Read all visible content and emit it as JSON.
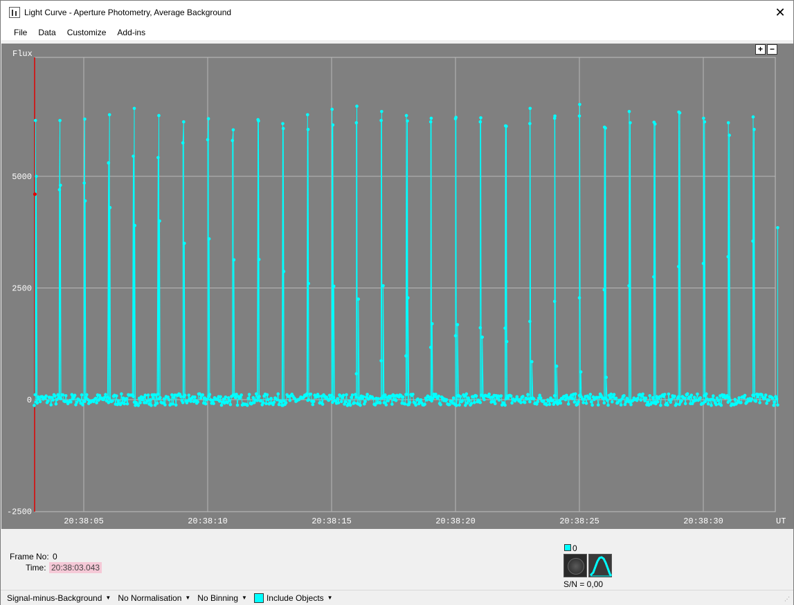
{
  "window": {
    "title": "Light Curve - Aperture Photometry, Average Background",
    "close_glyph": "✕"
  },
  "menu": {
    "items": [
      "File",
      "Data",
      "Customize",
      "Add-ins"
    ]
  },
  "zoom": {
    "plus": "+",
    "minus": "−"
  },
  "chart_data": {
    "type": "line",
    "ylabel": "Flux",
    "xlabel": "UT",
    "ylim": [
      -2500,
      7700
    ],
    "xlim": [
      3.0,
      33.0
    ],
    "yticks": [
      -2500,
      0,
      2500,
      5000
    ],
    "ytick_labels": [
      "-2500",
      "0",
      "2500",
      "5000"
    ],
    "xticks": [
      5,
      10,
      15,
      20,
      25,
      30
    ],
    "xtick_labels": [
      "20:38:05",
      "20:38:10",
      "20:38:15",
      "20:38:20",
      "20:38:25",
      "20:38:30"
    ],
    "grid": true,
    "series": [
      {
        "color": "#00ffff",
        "baseline": 0,
        "noise": 130,
        "peaks": [
          {
            "x": 3.05,
            "y": 6250
          },
          {
            "x": 4.04,
            "y": 6250
          },
          {
            "x": 5.04,
            "y": 6280
          },
          {
            "x": 6.04,
            "y": 6380
          },
          {
            "x": 7.04,
            "y": 6520
          },
          {
            "x": 8.03,
            "y": 6360
          },
          {
            "x": 9.03,
            "y": 6220
          },
          {
            "x": 10.03,
            "y": 6290
          },
          {
            "x": 11.03,
            "y": 6040
          },
          {
            "x": 12.03,
            "y": 6270
          },
          {
            "x": 13.03,
            "y": 6180
          },
          {
            "x": 14.03,
            "y": 6380
          },
          {
            "x": 15.02,
            "y": 6500
          },
          {
            "x": 16.02,
            "y": 6570
          },
          {
            "x": 17.02,
            "y": 6450
          },
          {
            "x": 18.02,
            "y": 6360
          },
          {
            "x": 19.02,
            "y": 6300
          },
          {
            "x": 20.02,
            "y": 6320
          },
          {
            "x": 21.02,
            "y": 6310
          },
          {
            "x": 22.02,
            "y": 6130
          },
          {
            "x": 23.01,
            "y": 6520
          },
          {
            "x": 24.01,
            "y": 6350
          },
          {
            "x": 25.01,
            "y": 6610
          },
          {
            "x": 26.01,
            "y": 6100
          },
          {
            "x": 27.01,
            "y": 6450
          },
          {
            "x": 28.01,
            "y": 6210
          },
          {
            "x": 29.01,
            "y": 6440
          },
          {
            "x": 30.01,
            "y": 6300
          },
          {
            "x": 31.01,
            "y": 6200
          },
          {
            "x": 32.01,
            "y": 6330
          }
        ],
        "mid_points": [
          {
            "x": 4.02,
            "y": 4700
          },
          {
            "x": 4.06,
            "y": 4800
          },
          {
            "x": 5.02,
            "y": 4850
          },
          {
            "x": 5.06,
            "y": 4450
          },
          {
            "x": 6.0,
            "y": 5300
          },
          {
            "x": 6.06,
            "y": 4300
          },
          {
            "x": 7.0,
            "y": 5450
          },
          {
            "x": 7.06,
            "y": 3900
          },
          {
            "x": 8.0,
            "y": 5420
          },
          {
            "x": 8.06,
            "y": 4000
          },
          {
            "x": 9.0,
            "y": 5750
          },
          {
            "x": 9.06,
            "y": 3500
          },
          {
            "x": 10.0,
            "y": 5820
          },
          {
            "x": 10.06,
            "y": 3600
          },
          {
            "x": 11.0,
            "y": 5800
          },
          {
            "x": 11.06,
            "y": 3130
          },
          {
            "x": 12.05,
            "y": 6240
          },
          {
            "x": 12.07,
            "y": 3140
          },
          {
            "x": 13.05,
            "y": 6070
          },
          {
            "x": 13.07,
            "y": 2870
          },
          {
            "x": 14.05,
            "y": 6050
          },
          {
            "x": 14.07,
            "y": 2600
          },
          {
            "x": 15.05,
            "y": 6150
          },
          {
            "x": 15.09,
            "y": 2540
          },
          {
            "x": 16.0,
            "y": 6200
          },
          {
            "x": 16.08,
            "y": 2250
          },
          {
            "x": 17.0,
            "y": 6250
          },
          {
            "x": 17.08,
            "y": 2550
          },
          {
            "x": 18.06,
            "y": 6240
          },
          {
            "x": 18.08,
            "y": 2280
          },
          {
            "x": 19.0,
            "y": 6220
          },
          {
            "x": 19.06,
            "y": 1700
          },
          {
            "x": 20.0,
            "y": 6290
          },
          {
            "x": 20.08,
            "y": 1680
          },
          {
            "x": 21.0,
            "y": 6220
          },
          {
            "x": 21.08,
            "y": 1400
          },
          {
            "x": 22.05,
            "y": 6120
          },
          {
            "x": 22.07,
            "y": 1300
          },
          {
            "x": 23.0,
            "y": 6180
          },
          {
            "x": 23.08,
            "y": 850
          },
          {
            "x": 24.0,
            "y": 6300
          },
          {
            "x": 24.08,
            "y": 750
          },
          {
            "x": 25.0,
            "y": 6350
          },
          {
            "x": 25.06,
            "y": 620
          },
          {
            "x": 26.05,
            "y": 6080
          },
          {
            "x": 26.08,
            "y": 500
          },
          {
            "x": 27.05,
            "y": 6200
          },
          {
            "x": 27.0,
            "y": 2550
          },
          {
            "x": 28.05,
            "y": 6170
          },
          {
            "x": 28.0,
            "y": 2750
          },
          {
            "x": 29.05,
            "y": 6420
          },
          {
            "x": 29.0,
            "y": 2980
          },
          {
            "x": 30.05,
            "y": 6220
          },
          {
            "x": 30.0,
            "y": 3050
          },
          {
            "x": 31.05,
            "y": 5920
          },
          {
            "x": 31.0,
            "y": 3200
          },
          {
            "x": 32.05,
            "y": 6050
          },
          {
            "x": 32.0,
            "y": 3550
          },
          {
            "x": 3.08,
            "y": 5000
          },
          {
            "x": 6.0,
            "y": 5300
          },
          {
            "x": 16.0,
            "y": 580
          },
          {
            "x": 17.0,
            "y": 870
          },
          {
            "x": 18.0,
            "y": 980
          },
          {
            "x": 19.0,
            "y": 1170
          },
          {
            "x": 20.0,
            "y": 1430
          },
          {
            "x": 21.0,
            "y": 1610
          },
          {
            "x": 22.0,
            "y": 1600
          },
          {
            "x": 23.0,
            "y": 1750
          },
          {
            "x": 24.0,
            "y": 2200
          },
          {
            "x": 25.0,
            "y": 2280
          },
          {
            "x": 26.0,
            "y": 2460
          },
          {
            "x": 33.0,
            "y": 3850
          }
        ],
        "marker": {
          "x": 3.0,
          "y": 4600,
          "color": "#e00000"
        }
      }
    ]
  },
  "info": {
    "frame_label": "Frame No:",
    "frame_value": "0",
    "time_label": "Time:",
    "time_value": "20:38:03.043",
    "object_index": "0",
    "sn_label": "S/N =  0,00"
  },
  "status": {
    "signal": "Signal-minus-Background",
    "normalisation": "No Normalisation",
    "binning": "No Binning",
    "include": "Include Objects"
  }
}
